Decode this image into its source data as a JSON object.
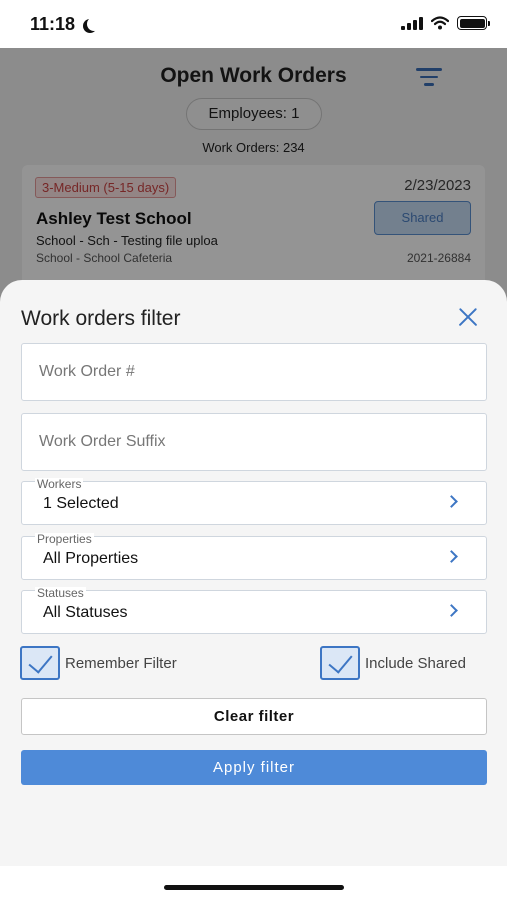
{
  "status_bar": {
    "time": "11:18"
  },
  "background": {
    "title": "Open Work Orders",
    "employees_pill": "Employees: 1",
    "work_orders_count": "Work Orders: 234",
    "card": {
      "priority": "3-Medium (5-15 days)",
      "date": "2/23/2023",
      "title": "Ashley Test School",
      "shared_label": "Shared",
      "subtitle": "School - Sch - Testing file uploa",
      "location": "School - School Cafeteria",
      "number": "2021-26884"
    }
  },
  "filter_sheet": {
    "title": "Work orders filter",
    "work_order_number": {
      "placeholder": "Work Order #",
      "value": ""
    },
    "work_order_suffix": {
      "placeholder": "Work Order Suffix",
      "value": ""
    },
    "workers": {
      "label": "Workers",
      "value": "1 Selected"
    },
    "properties": {
      "label": "Properties",
      "value": "All Properties"
    },
    "statuses": {
      "label": "Statuses",
      "value": "All Statuses"
    },
    "remember_filter": {
      "label": "Remember Filter",
      "checked": true
    },
    "include_shared": {
      "label": "Include Shared",
      "checked": true
    },
    "clear_label": "Clear filter",
    "apply_label": "Apply filter"
  },
  "colors": {
    "accent": "#3d76c4",
    "apply_button": "#4e8ad8",
    "priority_text": "#cc4444"
  }
}
